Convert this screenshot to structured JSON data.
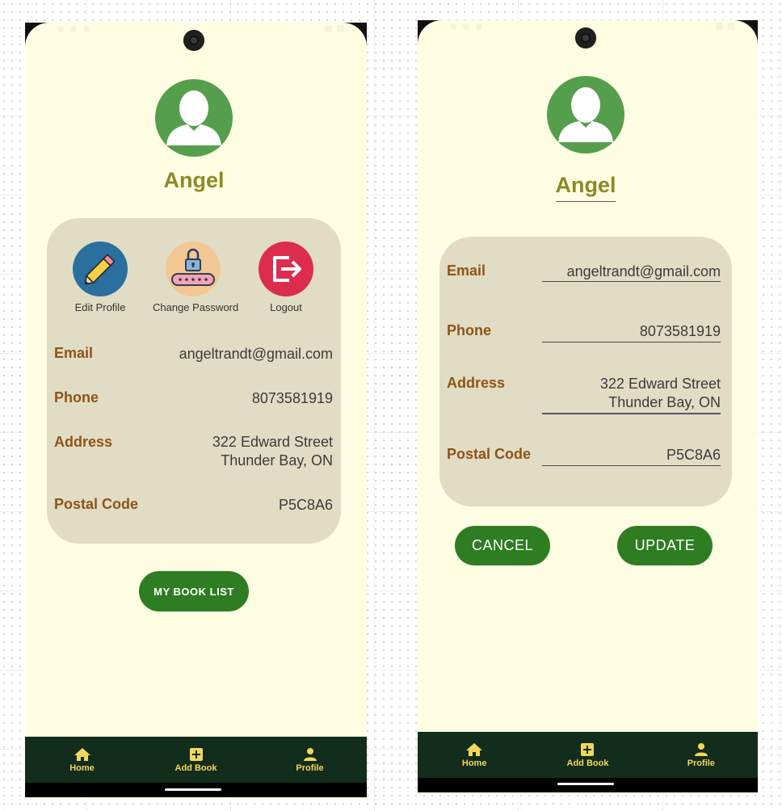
{
  "screens": {
    "view": {
      "user_name": "Angel",
      "actions": [
        {
          "label": "Edit Profile",
          "icon": "pencil-icon",
          "color": "#2a6f9e"
        },
        {
          "label": "Change Password",
          "icon": "password-lock-icon",
          "color": "#f2c793"
        },
        {
          "label": "Logout",
          "icon": "logout-icon",
          "color": "#dc2d4f"
        }
      ],
      "fields": {
        "email": {
          "label": "Email",
          "value": "angeltrandt@gmail.com"
        },
        "phone": {
          "label": "Phone",
          "value": "8073581919"
        },
        "address": {
          "label": "Address",
          "value": "322 Edward Street\nThunder Bay, ON"
        },
        "postal": {
          "label": "Postal Code",
          "value": "P5C8A6"
        }
      },
      "book_list_button": "MY BOOK LIST"
    },
    "edit": {
      "user_name": "Angel",
      "fields": {
        "email": {
          "label": "Email",
          "value": "angeltrandt@gmail.com"
        },
        "phone": {
          "label": "Phone",
          "value": "8073581919"
        },
        "address": {
          "label": "Address",
          "value": "322 Edward Street\nThunder Bay, ON"
        },
        "postal": {
          "label": "Postal Code",
          "value": "P5C8A6"
        }
      },
      "cancel_button": "CANCEL",
      "update_button": "UPDATE"
    }
  },
  "nav": {
    "home": "Home",
    "add_book": "Add Book",
    "profile": "Profile"
  },
  "colors": {
    "background": "#fffee3",
    "card": "#e1dcc4",
    "label": "#8e5417",
    "name": "#8c8a26",
    "button": "#2e7d22",
    "nav_bg": "#132d1d",
    "nav_fg": "#f3d75a",
    "avatar": "#559f4c"
  }
}
